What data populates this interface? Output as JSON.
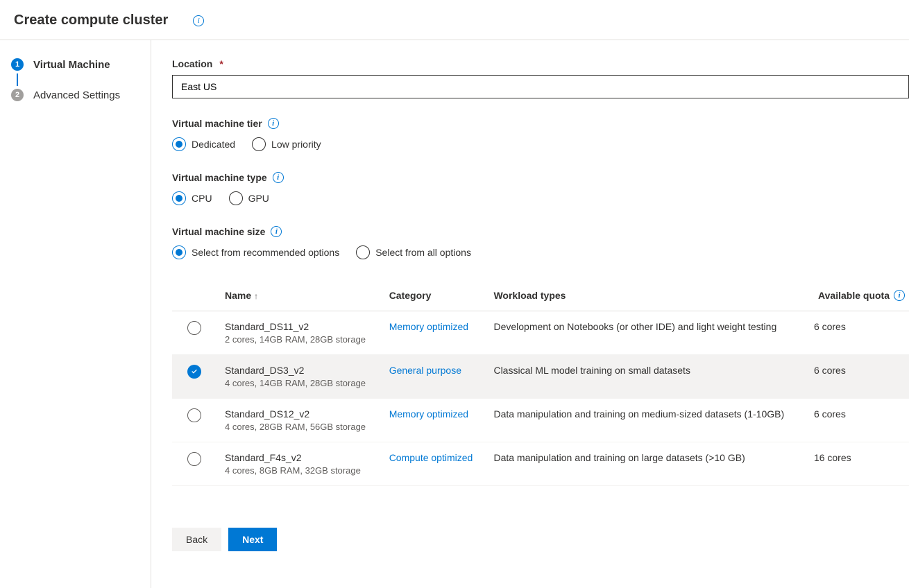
{
  "header": {
    "title": "Create compute cluster"
  },
  "steps": [
    {
      "number": "1",
      "label": "Virtual Machine",
      "active": true
    },
    {
      "number": "2",
      "label": "Advanced Settings",
      "active": false
    }
  ],
  "location": {
    "label": "Location",
    "value": "East US"
  },
  "vm_tier": {
    "label": "Virtual machine tier",
    "options": {
      "dedicated": "Dedicated",
      "low_priority": "Low priority"
    },
    "selected": "dedicated"
  },
  "vm_type": {
    "label": "Virtual machine type",
    "options": {
      "cpu": "CPU",
      "gpu": "GPU"
    },
    "selected": "cpu"
  },
  "vm_size": {
    "label": "Virtual machine size",
    "options": {
      "recommended": "Select from recommended options",
      "all": "Select from all options"
    },
    "selected": "recommended"
  },
  "table": {
    "headers": {
      "name": "Name",
      "category": "Category",
      "workload": "Workload types",
      "quota": "Available quota"
    },
    "rows": [
      {
        "name": "Standard_DS11_v2",
        "sub": "2 cores, 14GB RAM, 28GB storage",
        "category": "Memory optimized",
        "workload": "Development on Notebooks (or other IDE) and light weight testing",
        "quota": "6 cores",
        "selected": false
      },
      {
        "name": "Standard_DS3_v2",
        "sub": "4 cores, 14GB RAM, 28GB storage",
        "category": "General purpose",
        "workload": "Classical ML model training on small datasets",
        "quota": "6 cores",
        "selected": true
      },
      {
        "name": "Standard_DS12_v2",
        "sub": "4 cores, 28GB RAM, 56GB storage",
        "category": "Memory optimized",
        "workload": "Data manipulation and training on medium-sized datasets (1-10GB)",
        "quota": "6 cores",
        "selected": false
      },
      {
        "name": "Standard_F4s_v2",
        "sub": "4 cores, 8GB RAM, 32GB storage",
        "category": "Compute optimized",
        "workload": "Data manipulation and training on large datasets (>10 GB)",
        "quota": "16 cores",
        "selected": false
      }
    ]
  },
  "footer": {
    "back": "Back",
    "next": "Next"
  }
}
